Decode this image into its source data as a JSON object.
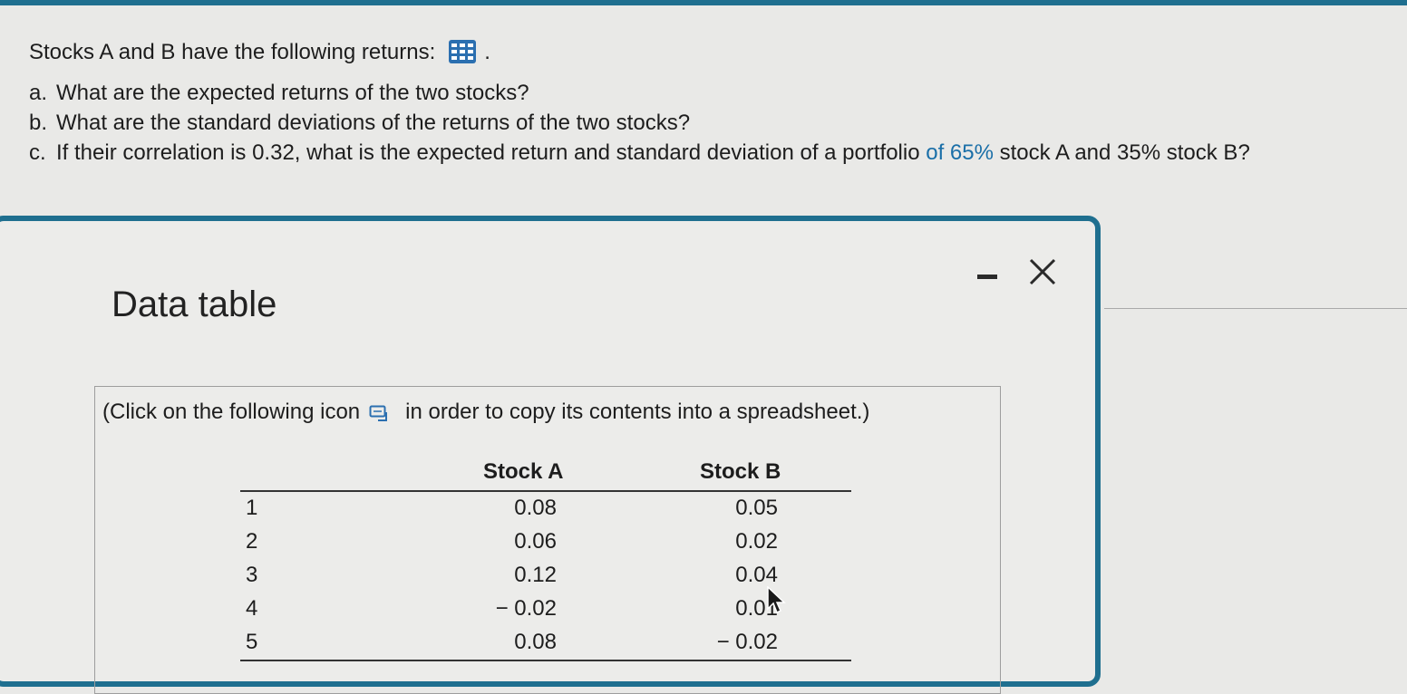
{
  "question": {
    "intro": "Stocks A and B have the following returns:",
    "intro_icon": "spreadsheet-grid-icon",
    "intro_period": ".",
    "items": [
      {
        "letter": "a.",
        "text": "What are the expected returns of the two stocks?"
      },
      {
        "letter": "b.",
        "text": "What are the standard deviations of the returns of the two stocks?"
      },
      {
        "letter": "c.",
        "text_before": "If their correlation is 0.32, what is the expected return and standard deviation of a portfolio ",
        "text_highlight": "of 65%",
        "text_after": " stock A and 35% stock B?"
      }
    ]
  },
  "dialog": {
    "title": "Data table",
    "minimize_icon": "minimize-icon",
    "close_icon": "close-icon",
    "instruction_before": "(Click on the following icon",
    "instruction_icon": "copy-to-spreadsheet-icon",
    "instruction_after": "in order to copy its contents into a spreadsheet.)",
    "table": {
      "headers": [
        "",
        "Stock A",
        "Stock B"
      ],
      "rows": [
        {
          "idx": "1",
          "a": "0.08",
          "b": "0.05"
        },
        {
          "idx": "2",
          "a": "0.06",
          "b": "0.02"
        },
        {
          "idx": "3",
          "a": "0.12",
          "b": "0.04"
        },
        {
          "idx": "4",
          "a": "− 0.02",
          "b": "0.01"
        },
        {
          "idx": "5",
          "a": "0.08",
          "b": "− 0.02"
        }
      ]
    }
  },
  "colors": {
    "accent": "#1f6f8f",
    "highlight_text": "#1a6fa8",
    "icon_blue": "#2b6fb0"
  }
}
